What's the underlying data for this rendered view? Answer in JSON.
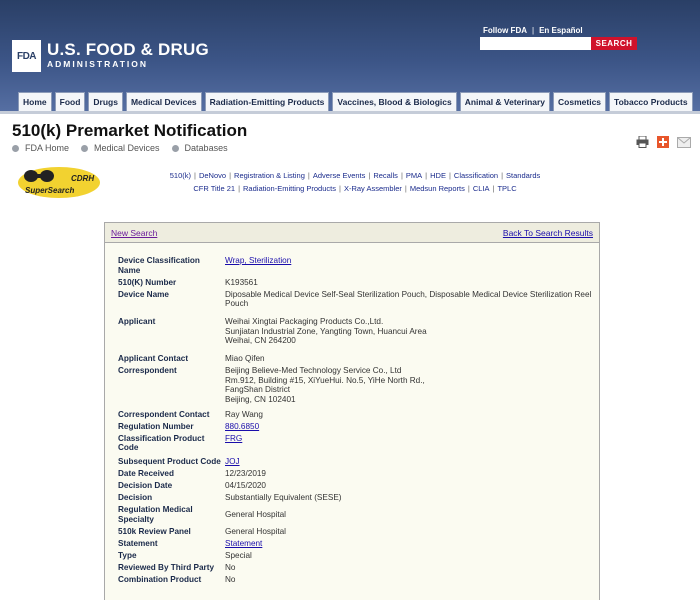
{
  "header": {
    "logo_text": "FDA",
    "title": "U.S. FOOD & DRUG",
    "subtitle": "ADMINISTRATION",
    "follow_fda": "Follow FDA",
    "separator": "|",
    "espanol": "En Español",
    "search_placeholder": "",
    "search_button": "SEARCH"
  },
  "nav": {
    "tabs": [
      {
        "label": "Home"
      },
      {
        "label": "Food"
      },
      {
        "label": "Drugs"
      },
      {
        "label": "Medical Devices"
      },
      {
        "label": "Radiation-Emitting Products"
      },
      {
        "label": "Vaccines, Blood & Biologics"
      },
      {
        "label": "Animal & Veterinary"
      },
      {
        "label": "Cosmetics"
      },
      {
        "label": "Tobacco Products"
      }
    ]
  },
  "page": {
    "title": "510(k) Premarket Notification",
    "breadcrumb": [
      "FDA Home",
      "Medical Devices",
      "Databases"
    ]
  },
  "icons": {
    "print": "print-icon",
    "share": "plus-share-icon",
    "email": "email-icon"
  },
  "cdrh": {
    "logo_top": "CDRH",
    "logo_bottom": "SuperSearch",
    "links_row1": [
      "510(k)",
      "DeNovo",
      "Registration & Listing",
      "Adverse Events",
      "Recalls",
      "PMA",
      "HDE",
      "Classification",
      "Standards"
    ],
    "links_row2": [
      "CFR Title 21",
      "Radiation-Emitting Products",
      "X-Ray Assembler",
      "Medsun Reports",
      "CLIA",
      "TPLC"
    ]
  },
  "box": {
    "new_search": "New Search",
    "back_to_results": "Back To Search Results"
  },
  "details": {
    "device_classification_name_label": "Device Classification Name",
    "device_classification_name": "Wrap, Sterilization",
    "k_number_label": "510(K) Number",
    "k_number": "K193561",
    "device_name_label": "Device Name",
    "device_name": "Diposable Medical Device Self-Seal Sterilization Pouch, Disposable Medical Device Sterilization Reel Pouch",
    "applicant_label": "Applicant",
    "applicant_lines": [
      "Weihai Xingtai Packaging Products Co.,Ltd.",
      "Sunjiatan Industrial Zone, Yangting Town, Huancui Area",
      "Weihai,  CN 264200"
    ],
    "applicant_contact_label": "Applicant Contact",
    "applicant_contact": "Miao Qifen",
    "correspondent_label": "Correspondent",
    "correspondent_lines": [
      "Beijing Believe-Med Technology Service Co., Ltd",
      "Rm.912, Building #15, XiYueHui. No.5, YiHe North Rd.,",
      "FangShan District",
      "Beijing,  CN 102401"
    ],
    "correspondent_contact_label": "Correspondent Contact",
    "correspondent_contact": "Ray Wang",
    "regulation_number_label": "Regulation Number",
    "regulation_number": "880.6850",
    "classification_product_code_label": "Classification Product Code",
    "classification_product_code": "FRG",
    "subsequent_product_code_label": "Subsequent Product Code",
    "subsequent_product_code": "JOJ",
    "date_received_label": "Date Received",
    "date_received": "12/23/2019",
    "decision_date_label": "Decision Date",
    "decision_date": "04/15/2020",
    "decision_label": "Decision",
    "decision": "Substantially Equivalent (SESE)",
    "regulation_medical_specialty_label": "Regulation Medical Specialty",
    "regulation_medical_specialty": "General Hospital",
    "review_panel_label": "510k Review Panel",
    "review_panel": "General Hospital",
    "statement_label": "Statement",
    "statement": "Statement",
    "type_label": "Type",
    "type": "Special",
    "third_party_label": "Reviewed By Third Party",
    "third_party": "No",
    "combination_label": "Combination Product",
    "combination": "No"
  },
  "colors": {
    "header_dark": "#2a3f66",
    "search_red": "#d0122b",
    "link_blue": "#1a0dab",
    "label_navy": "#1b2a4a",
    "box_bg": "#fbfbf1"
  }
}
